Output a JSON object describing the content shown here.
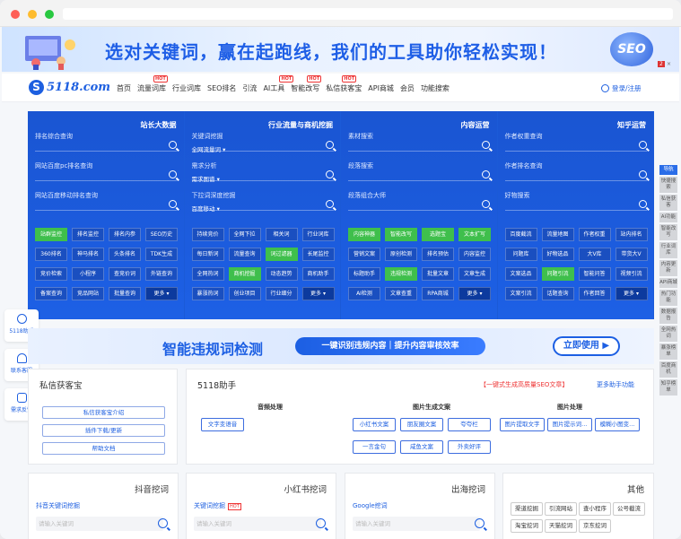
{
  "banner": {
    "text": "选对关键词，赢在起跑线，我们的工具助你轻松实现！",
    "badge": "SEO",
    "close": "×",
    "pager": "2"
  },
  "nav": {
    "logo_mark": "S",
    "logo_text": "5118.com",
    "items": [
      {
        "label": "首页"
      },
      {
        "label": "流量词库",
        "hot": "HOT"
      },
      {
        "label": "行业词库"
      },
      {
        "label": "SEO排名"
      },
      {
        "label": "引流"
      },
      {
        "label": "AI工具",
        "hot": "HOT"
      },
      {
        "label": "智能改写",
        "hot": "HOT"
      },
      {
        "label": "私信获客宝",
        "hot": "HOT"
      },
      {
        "label": "API商城"
      },
      {
        "label": "会员"
      },
      {
        "label": "功能搜索"
      }
    ],
    "login": "登录/注册"
  },
  "panel": {
    "cols": [
      {
        "title": "站长大数据",
        "fields": [
          {
            "label": "排名综合查询",
            "sub": ""
          },
          {
            "label": "网站百度pc排名查询",
            "sub": ""
          },
          {
            "label": "网站百度移动排名查询",
            "sub": ""
          }
        ],
        "tags": [
          {
            "t": "站群监控",
            "g": true
          },
          {
            "t": "排名监控"
          },
          {
            "t": "排名内参"
          },
          {
            "t": "SEO历史"
          },
          {
            "t": "360排名"
          },
          {
            "t": "神马排名"
          },
          {
            "t": "头条排名"
          },
          {
            "t": "TDK生成"
          },
          {
            "t": "竞价检索"
          },
          {
            "t": "小程序"
          },
          {
            "t": "查竞价词"
          },
          {
            "t": "外链查询"
          },
          {
            "t": "备案查询"
          },
          {
            "t": "竞品网站"
          },
          {
            "t": "批量查询"
          },
          {
            "t": "更多 ▾",
            "m": true
          }
        ]
      },
      {
        "title": "行业流量与商机挖掘",
        "fields": [
          {
            "label": "关键词挖掘",
            "sub": "全网流量词 ▾"
          },
          {
            "label": "需求分析",
            "sub": "需求图谱 ▾"
          },
          {
            "label": "下拉词深度挖掘",
            "sub": "百度移动 ▾"
          }
        ],
        "tags": [
          {
            "t": "持续竞价"
          },
          {
            "t": "全网下拉"
          },
          {
            "t": "相关词"
          },
          {
            "t": "行业词库"
          },
          {
            "t": "每日新词"
          },
          {
            "t": "流量查询"
          },
          {
            "t": "词过滤器",
            "g": true
          },
          {
            "t": "长尾监控"
          },
          {
            "t": "全网热词"
          },
          {
            "t": "商机挖掘",
            "g": true
          },
          {
            "t": "动态趋势"
          },
          {
            "t": "商机助手"
          },
          {
            "t": "暴涨热词"
          },
          {
            "t": "创业项目"
          },
          {
            "t": "行业细分"
          },
          {
            "t": "更多 ▾",
            "m": true
          }
        ]
      },
      {
        "title": "内容运营",
        "fields": [
          {
            "label": "素材搜索",
            "sub": ""
          },
          {
            "label": "段落搜索",
            "sub": ""
          },
          {
            "label": "段落组合大师",
            "sub": ""
          }
        ],
        "tags": [
          {
            "t": "内容神器",
            "g": true
          },
          {
            "t": "智能改写",
            "g": true
          },
          {
            "t": "选题宝",
            "g": true
          },
          {
            "t": "文本扩写",
            "g": true
          },
          {
            "t": "营销文案"
          },
          {
            "t": "原创检测"
          },
          {
            "t": "排名预估"
          },
          {
            "t": "内容监控"
          },
          {
            "t": "标题助手"
          },
          {
            "t": "违规检测",
            "g": true
          },
          {
            "t": "批量文章"
          },
          {
            "t": "文章生成"
          },
          {
            "t": "AI检测"
          },
          {
            "t": "文章查重"
          },
          {
            "t": "RPA商城"
          },
          {
            "t": "更多 ▾",
            "m": true
          }
        ]
      },
      {
        "title": "知乎运营",
        "fields": [
          {
            "label": "作者权重查询",
            "sub": ""
          },
          {
            "label": "作者排名查询",
            "sub": ""
          },
          {
            "label": "好物搜索",
            "sub": ""
          }
        ],
        "tags": [
          {
            "t": "百度截流"
          },
          {
            "t": "流量地图"
          },
          {
            "t": "作者权重"
          },
          {
            "t": "站内排名"
          },
          {
            "t": "问题库"
          },
          {
            "t": "好物选品"
          },
          {
            "t": "大V库"
          },
          {
            "t": "带货大V"
          },
          {
            "t": "文案选品"
          },
          {
            "t": "问题引流",
            "g": true
          },
          {
            "t": "智能问答"
          },
          {
            "t": "视频引流"
          },
          {
            "t": "文案引流"
          },
          {
            "t": "话题查询"
          },
          {
            "t": "作者回答"
          },
          {
            "t": "更多 ▾",
            "m": true
          }
        ]
      }
    ]
  },
  "rnav": [
    {
      "t": "导航",
      "a": true
    },
    {
      "t": "快捷搜索"
    },
    {
      "t": "私信获客"
    },
    {
      "t": "AI功能"
    },
    {
      "t": "智能改写"
    },
    {
      "t": "行业词库"
    },
    {
      "t": "内容更新"
    },
    {
      "t": "API商城"
    },
    {
      "t": "热门功能"
    },
    {
      "t": "数据报告"
    },
    {
      "t": "全网热词"
    },
    {
      "t": "暴涨榜单"
    },
    {
      "t": "百度商机"
    },
    {
      "t": "知乎榜单"
    }
  ],
  "left_float": [
    {
      "t": "5118助手"
    },
    {
      "t": "联系客服"
    },
    {
      "t": "需求反馈"
    }
  ],
  "ad2": {
    "title": "智能违规词检测",
    "pill": "一键识别违规内容｜提升内容审核效率",
    "btn": "立即使用 ▶"
  },
  "private": {
    "title": "私信获客宝",
    "buttons": [
      "私信获客宝介绍",
      "插件下载/更新",
      "帮助文档"
    ]
  },
  "assistant": {
    "title": "5118助手",
    "promo": "【一键式生成高质量SEO文章】",
    "more": "更多助手功能",
    "sections": [
      "音频处理",
      "图片生成文案",
      "图片处理"
    ],
    "audio": [
      "文字变语音"
    ],
    "imgtext": [
      "小红书文案",
      "朋友圈文案",
      "夸夸栏",
      "一言金句",
      "咸鱼文案",
      "外卖好评"
    ],
    "imgproc": [
      "图片提取文字",
      "图片提示词...",
      "模糊小图变..."
    ]
  },
  "bottom": [
    {
      "title": "抖音挖词",
      "label": "抖音关键词挖掘",
      "hot": "",
      "placeholder": "请输入关键词"
    },
    {
      "title": "小红书挖词",
      "label": "关键词挖掘",
      "hot": "HOT",
      "placeholder": "请输入关键词"
    },
    {
      "title": "出海挖词",
      "label": "Google挖词",
      "hot": "",
      "placeholder": "请输入关键词"
    }
  ],
  "other": {
    "title": "其他",
    "items": [
      "渠道挖掘",
      "引流网站",
      "查小程序",
      "公号截流",
      "淘宝挖词",
      "天猫挖词",
      "京东挖词"
    ]
  }
}
